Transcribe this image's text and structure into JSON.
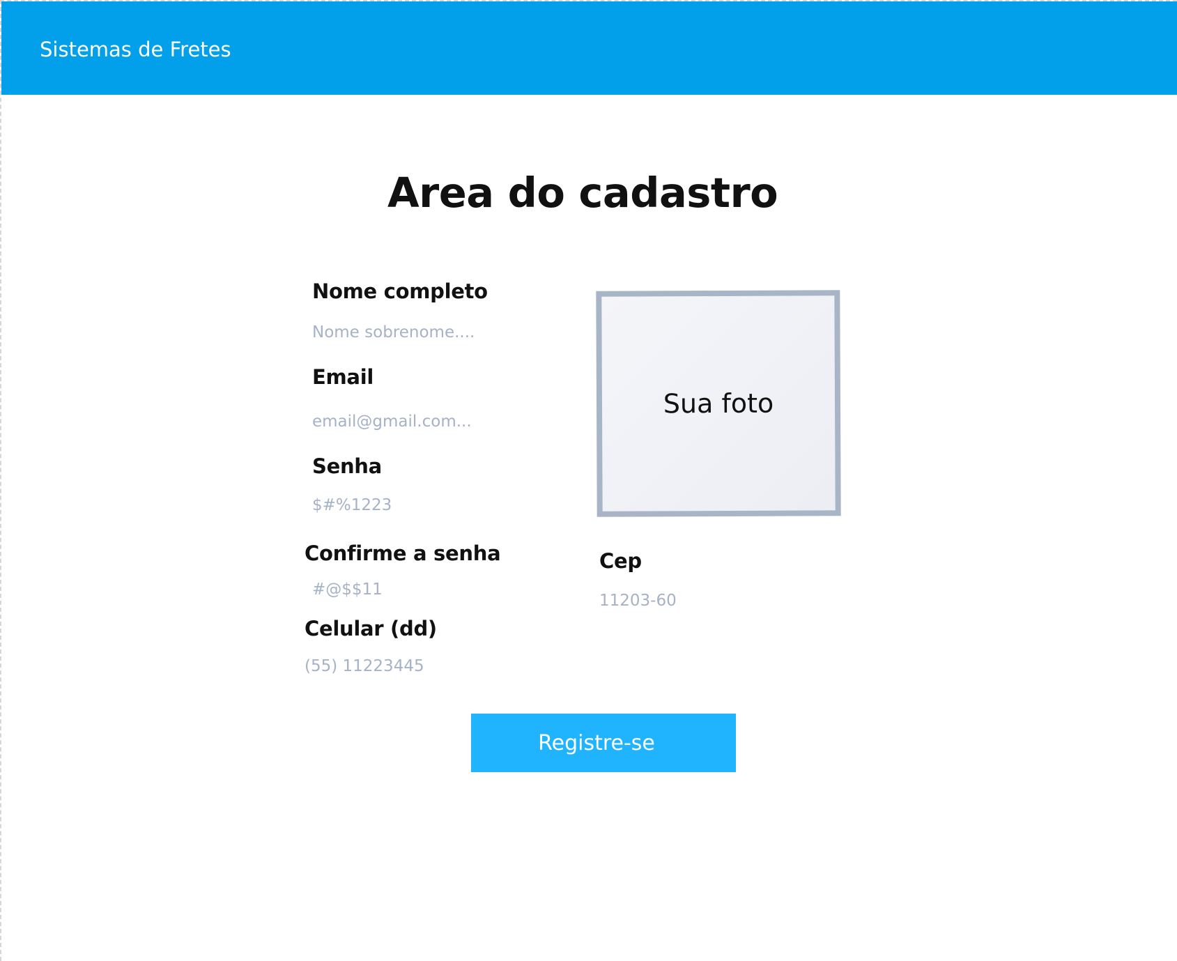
{
  "header": {
    "app_title": "Sistemas de Fretes"
  },
  "page": {
    "title": "Area do cadastro"
  },
  "form": {
    "nome": {
      "label": "Nome completo",
      "placeholder": "Nome sobrenome....",
      "value": ""
    },
    "email": {
      "label": "Email",
      "placeholder": "email@gmail.com...",
      "value": ""
    },
    "senha": {
      "label": "Senha",
      "placeholder": "$#%1223",
      "value": ""
    },
    "confirme_senha": {
      "label": "Confirme a senha",
      "placeholder": "#@$$11",
      "value": ""
    },
    "celular": {
      "label": "Celular (dd)",
      "placeholder": "(55) 11223445",
      "value": ""
    },
    "cep": {
      "label": "Cep",
      "placeholder": "11203-60",
      "value": ""
    },
    "photo": {
      "label": "Sua foto"
    },
    "submit_label": "Registre-se"
  },
  "colors": {
    "header_bg": "#029fea",
    "button_bg": "#1fb4fd",
    "placeholder": "#a6b2c6",
    "photo_border": "#a8b5c7"
  }
}
